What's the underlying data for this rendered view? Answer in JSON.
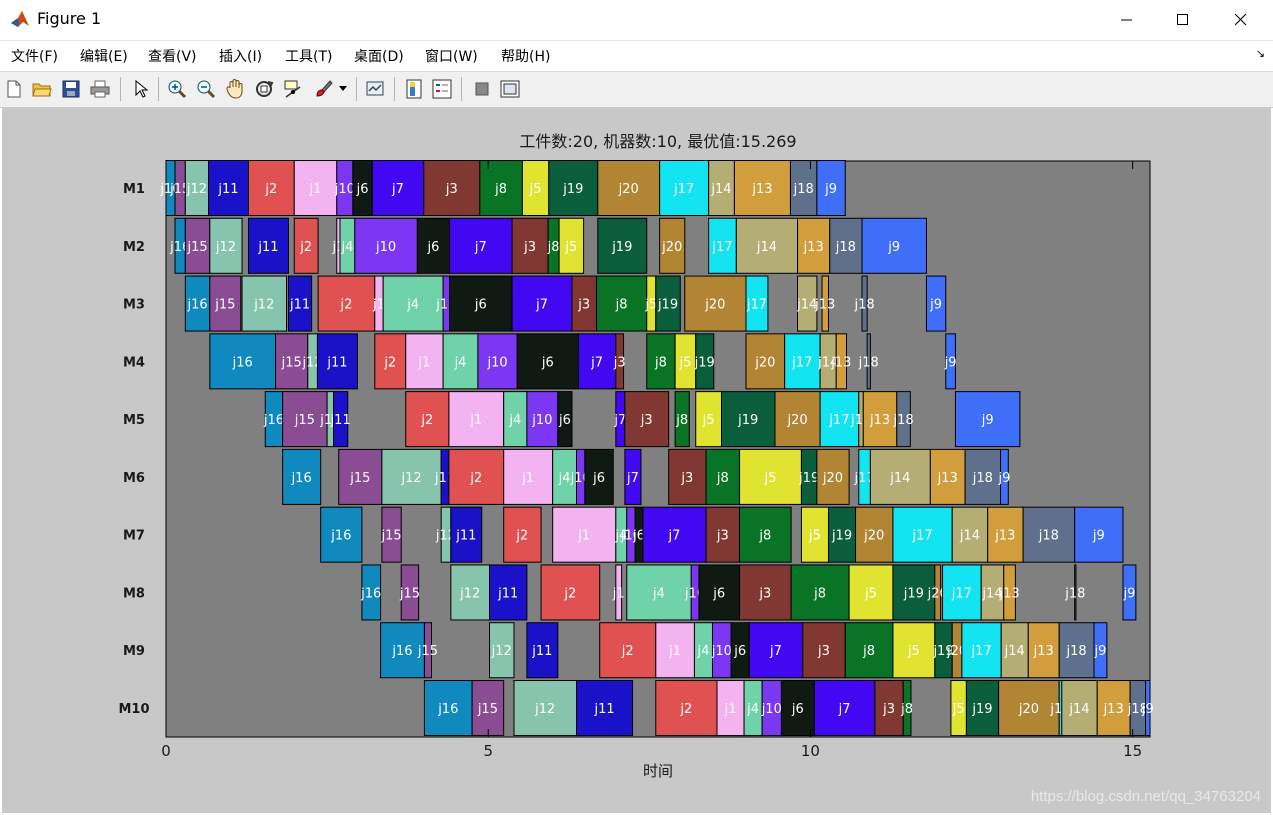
{
  "window": {
    "title": "Figure 1",
    "minimize_icon": "minimize-icon",
    "maximize_icon": "maximize-icon",
    "close_icon": "close-icon",
    "app_icon": "matlab-logo-icon"
  },
  "menu": [
    "文件(F)",
    "编辑(E)",
    "查看(V)",
    "插入(I)",
    "工具(T)",
    "桌面(D)",
    "窗口(W)",
    "帮助(H)"
  ],
  "toolbar": [
    {
      "name": "new-figure-button",
      "icon": "new-file-icon"
    },
    {
      "name": "open-file-button",
      "icon": "open-folder-icon"
    },
    {
      "name": "save-figure-button",
      "icon": "save-icon"
    },
    {
      "name": "print-figure-button",
      "icon": "printer-icon"
    },
    {
      "name": "edit-plot-button",
      "icon": "pointer-icon"
    },
    {
      "name": "zoom-in-button",
      "icon": "zoom-in-icon"
    },
    {
      "name": "zoom-out-button",
      "icon": "zoom-out-icon"
    },
    {
      "name": "pan-button",
      "icon": "hand-icon"
    },
    {
      "name": "rotate-3d-button",
      "icon": "rotate-icon"
    },
    {
      "name": "data-cursor-button",
      "icon": "data-cursor-icon"
    },
    {
      "name": "brush-button",
      "icon": "brush-icon"
    },
    {
      "name": "brush-dropdown-button",
      "icon": "caret-down-icon"
    },
    {
      "name": "link-plot-button",
      "icon": "link-plot-icon"
    },
    {
      "name": "insert-colorbar-button",
      "icon": "colorbar-icon"
    },
    {
      "name": "insert-legend-button",
      "icon": "legend-icon"
    },
    {
      "name": "hide-plot-tools-button",
      "icon": "hide-tools-icon"
    },
    {
      "name": "show-plot-tools-button",
      "icon": "show-tools-icon"
    }
  ],
  "watermark": "https://blog.csdn.net/qq_34763204",
  "colors": {
    "j1": "#f2b3f0",
    "j2": "#e05252",
    "j3": "#823832",
    "j4": "#6fd2a8",
    "j5": "#e0e430",
    "j6": "#0f1a12",
    "j7": "#4208f2",
    "j8": "#097426",
    "j9": "#3f6ef8",
    "j10": "#7b37f2",
    "j11": "#1a12c8",
    "j12": "#86c4ad",
    "j13": "#d29d3c",
    "j14": "#b4ad74",
    "j15": "#8a4d94",
    "j16": "#1089be",
    "j17": "#12e4f2",
    "j18": "#5f708c",
    "j19": "#0a5e3c",
    "j20": "#b28534",
    "plot_bg": "#808080",
    "figure_bg": "#c8c8c8"
  },
  "chart_data": {
    "type": "gantt",
    "title": "工件数:20, 机器数:10, 最优值:15.269",
    "xlabel": "时间",
    "ylabel": "",
    "xlim": [
      0,
      15.269
    ],
    "xticks": [
      0,
      5,
      10,
      15
    ],
    "machines": [
      "M1",
      "M2",
      "M3",
      "M4",
      "M5",
      "M6",
      "M7",
      "M8",
      "M9",
      "M10"
    ],
    "tasks": [
      [
        "M1",
        "j16",
        0.0,
        0.14
      ],
      [
        "M1",
        "j15",
        0.14,
        0.3
      ],
      [
        "M1",
        "j12",
        0.3,
        0.66
      ],
      [
        "M1",
        "j11",
        0.66,
        1.28
      ],
      [
        "M1",
        "j2",
        1.28,
        1.99
      ],
      [
        "M1",
        "j1",
        1.99,
        2.65
      ],
      [
        "M1",
        "j10",
        2.65,
        2.9
      ],
      [
        "M1",
        "j6",
        2.9,
        3.2
      ],
      [
        "M1",
        "j7",
        3.2,
        4.0
      ],
      [
        "M1",
        "j3",
        4.0,
        4.87
      ],
      [
        "M1",
        "j8",
        4.87,
        5.53
      ],
      [
        "M1",
        "j5",
        5.53,
        5.94
      ],
      [
        "M1",
        "j19",
        5.94,
        6.7
      ],
      [
        "M1",
        "j20",
        6.7,
        7.66
      ],
      [
        "M1",
        "j17",
        7.66,
        8.42
      ],
      [
        "M1",
        "j14",
        8.42,
        8.82
      ],
      [
        "M1",
        "j13",
        8.82,
        9.69
      ],
      [
        "M1",
        "j18",
        9.69,
        10.1
      ],
      [
        "M1",
        "j9",
        10.1,
        10.54
      ],
      [
        "M2",
        "j16",
        0.14,
        0.3
      ],
      [
        "M2",
        "j15",
        0.3,
        0.68
      ],
      [
        "M2",
        "j12",
        0.68,
        1.18
      ],
      [
        "M2",
        "j11",
        1.28,
        1.9
      ],
      [
        "M2",
        "j2",
        1.99,
        2.36
      ],
      [
        "M2",
        "j1",
        2.65,
        2.7
      ],
      [
        "M2",
        "j4",
        2.7,
        2.93
      ],
      [
        "M2",
        "j10",
        2.93,
        3.9
      ],
      [
        "M2",
        "j6",
        3.9,
        4.4
      ],
      [
        "M2",
        "j7",
        4.4,
        5.37
      ],
      [
        "M2",
        "j3",
        5.37,
        5.93
      ],
      [
        "M2",
        "j8",
        5.93,
        6.1
      ],
      [
        "M2",
        "j5",
        6.1,
        6.48
      ],
      [
        "M2",
        "j19",
        6.7,
        7.46
      ],
      [
        "M2",
        "j20",
        7.66,
        8.05
      ],
      [
        "M2",
        "j17",
        8.42,
        8.85
      ],
      [
        "M2",
        "j14",
        8.85,
        9.8
      ],
      [
        "M2",
        "j13",
        9.8,
        10.3
      ],
      [
        "M2",
        "j18",
        10.3,
        10.8
      ],
      [
        "M2",
        "j9",
        10.8,
        11.8
      ],
      [
        "M3",
        "j16",
        0.3,
        0.68
      ],
      [
        "M3",
        "j15",
        0.68,
        1.16
      ],
      [
        "M3",
        "j12",
        1.18,
        1.87
      ],
      [
        "M3",
        "j11",
        1.9,
        2.26
      ],
      [
        "M3",
        "j2",
        2.36,
        3.24
      ],
      [
        "M3",
        "j1",
        3.24,
        3.37
      ],
      [
        "M3",
        "j4",
        3.37,
        4.3
      ],
      [
        "M3",
        "j10",
        4.3,
        4.4
      ],
      [
        "M3",
        "j6",
        4.4,
        5.37
      ],
      [
        "M3",
        "j7",
        5.37,
        6.3
      ],
      [
        "M3",
        "j3",
        6.3,
        6.68
      ],
      [
        "M3",
        "j8",
        6.68,
        7.46
      ],
      [
        "M3",
        "j5",
        7.46,
        7.6
      ],
      [
        "M3",
        "j19",
        7.6,
        7.98
      ],
      [
        "M3",
        "j20",
        8.05,
        9.0
      ],
      [
        "M3",
        "j17",
        9.0,
        9.34
      ],
      [
        "M3",
        "j14",
        9.8,
        10.1
      ],
      [
        "M3",
        "j13",
        10.18,
        10.28
      ],
      [
        "M3",
        "j18",
        10.8,
        10.88
      ],
      [
        "M3",
        "j9",
        11.8,
        12.1
      ],
      [
        "M4",
        "j16",
        0.68,
        1.7
      ],
      [
        "M4",
        "j15",
        1.7,
        2.2
      ],
      [
        "M4",
        "j12",
        2.2,
        2.35
      ],
      [
        "M4",
        "j11",
        2.35,
        2.97
      ],
      [
        "M4",
        "j2",
        3.24,
        3.72
      ],
      [
        "M4",
        "j1",
        3.72,
        4.3
      ],
      [
        "M4",
        "j4",
        4.3,
        4.84
      ],
      [
        "M4",
        "j10",
        4.84,
        5.45
      ],
      [
        "M4",
        "j6",
        5.45,
        6.4
      ],
      [
        "M4",
        "j7",
        6.4,
        6.98
      ],
      [
        "M4",
        "j3",
        6.98,
        7.1
      ],
      [
        "M4",
        "j8",
        7.46,
        7.9
      ],
      [
        "M4",
        "j5",
        7.9,
        8.22
      ],
      [
        "M4",
        "j19",
        8.22,
        8.5
      ],
      [
        "M4",
        "j20",
        9.0,
        9.6
      ],
      [
        "M4",
        "j17",
        9.6,
        10.15
      ],
      [
        "M4",
        "j14",
        10.15,
        10.4
      ],
      [
        "M4",
        "j13",
        10.4,
        10.56
      ],
      [
        "M4",
        "j18",
        10.88,
        10.93
      ],
      [
        "M4",
        "j9",
        12.1,
        12.25
      ],
      [
        "M5",
        "j16",
        1.54,
        1.81
      ],
      [
        "M5",
        "j15",
        1.81,
        2.5
      ],
      [
        "M5",
        "j12",
        2.5,
        2.6
      ],
      [
        "M5",
        "j11",
        2.6,
        2.82
      ],
      [
        "M5",
        "j2",
        3.72,
        4.39
      ],
      [
        "M5",
        "j1",
        4.39,
        5.24
      ],
      [
        "M5",
        "j4",
        5.24,
        5.6
      ],
      [
        "M5",
        "j10",
        5.6,
        6.08
      ],
      [
        "M5",
        "j6",
        6.08,
        6.3
      ],
      [
        "M5",
        "j7",
        6.98,
        7.12
      ],
      [
        "M5",
        "j3",
        7.12,
        7.8
      ],
      [
        "M5",
        "j8",
        7.9,
        8.12
      ],
      [
        "M5",
        "j5",
        8.22,
        8.62
      ],
      [
        "M5",
        "j19",
        8.62,
        9.45
      ],
      [
        "M5",
        "j20",
        9.45,
        10.15
      ],
      [
        "M5",
        "j17",
        10.15,
        10.75
      ],
      [
        "M5",
        "j14",
        10.75,
        10.82
      ],
      [
        "M5",
        "j13",
        10.82,
        11.34
      ],
      [
        "M5",
        "j18",
        11.34,
        11.55
      ],
      [
        "M5",
        "j9",
        12.25,
        13.25
      ],
      [
        "M6",
        "j16",
        1.81,
        2.4
      ],
      [
        "M6",
        "j15",
        2.68,
        3.35
      ],
      [
        "M6",
        "j12",
        3.35,
        4.27
      ],
      [
        "M6",
        "j11",
        4.27,
        4.39
      ],
      [
        "M6",
        "j2",
        4.39,
        5.24
      ],
      [
        "M6",
        "j1",
        5.24,
        6.0
      ],
      [
        "M6",
        "j4",
        6.0,
        6.37
      ],
      [
        "M6",
        "j10",
        6.37,
        6.5
      ],
      [
        "M6",
        "j6",
        6.5,
        6.94
      ],
      [
        "M6",
        "j7",
        7.12,
        7.37
      ],
      [
        "M6",
        "j3",
        7.8,
        8.38
      ],
      [
        "M6",
        "j8",
        8.38,
        8.9
      ],
      [
        "M6",
        "j5",
        8.9,
        9.86
      ],
      [
        "M6",
        "j19",
        9.86,
        10.1
      ],
      [
        "M6",
        "j20",
        10.1,
        10.6
      ],
      [
        "M6",
        "j17",
        10.75,
        10.93
      ],
      [
        "M6",
        "j14",
        10.93,
        11.86
      ],
      [
        "M6",
        "j13",
        11.86,
        12.4
      ],
      [
        "M6",
        "j18",
        12.4,
        12.95
      ],
      [
        "M6",
        "j9",
        12.95,
        13.07
      ],
      [
        "M7",
        "j16",
        2.4,
        3.04
      ],
      [
        "M7",
        "j15",
        3.35,
        3.65
      ],
      [
        "M7",
        "j12",
        4.27,
        4.42
      ],
      [
        "M7",
        "j11",
        4.42,
        4.9
      ],
      [
        "M7",
        "j2",
        5.24,
        5.82
      ],
      [
        "M7",
        "j1",
        6.0,
        6.98
      ],
      [
        "M7",
        "j4",
        6.98,
        7.15
      ],
      [
        "M7",
        "j10",
        7.15,
        7.28
      ],
      [
        "M7",
        "j6",
        7.28,
        7.4
      ],
      [
        "M7",
        "j7",
        7.4,
        8.38
      ],
      [
        "M7",
        "j3",
        8.38,
        8.9
      ],
      [
        "M7",
        "j8",
        8.9,
        9.7
      ],
      [
        "M7",
        "j5",
        9.86,
        10.28
      ],
      [
        "M7",
        "j19",
        10.28,
        10.7
      ],
      [
        "M7",
        "j20",
        10.7,
        11.28
      ],
      [
        "M7",
        "j17",
        11.28,
        12.2
      ],
      [
        "M7",
        "j14",
        12.2,
        12.75
      ],
      [
        "M7",
        "j13",
        12.75,
        13.3
      ],
      [
        "M7",
        "j18",
        13.3,
        14.1
      ],
      [
        "M7",
        "j9",
        14.1,
        14.85
      ],
      [
        "M8",
        "j16",
        3.04,
        3.33
      ],
      [
        "M8",
        "j15",
        3.65,
        3.92
      ],
      [
        "M8",
        "j12",
        4.42,
        5.02
      ],
      [
        "M8",
        "j11",
        5.02,
        5.6
      ],
      [
        "M8",
        "j2",
        5.82,
        6.73
      ],
      [
        "M8",
        "j1",
        6.98,
        7.07
      ],
      [
        "M8",
        "j4",
        7.15,
        8.15
      ],
      [
        "M8",
        "j10",
        8.15,
        8.27
      ],
      [
        "M8",
        "j6",
        8.27,
        8.9
      ],
      [
        "M8",
        "j3",
        8.9,
        9.7
      ],
      [
        "M8",
        "j8",
        9.7,
        10.6
      ],
      [
        "M8",
        "j5",
        10.6,
        11.28
      ],
      [
        "M8",
        "j19",
        11.28,
        11.93
      ],
      [
        "M8",
        "j20",
        11.93,
        12.02
      ],
      [
        "M8",
        "j17",
        12.05,
        12.65
      ],
      [
        "M8",
        "j14",
        12.65,
        13.0
      ],
      [
        "M8",
        "j13",
        13.0,
        13.18
      ],
      [
        "M8",
        "j18",
        14.1,
        14.12
      ],
      [
        "M8",
        "j9",
        14.85,
        15.05
      ],
      [
        "M9",
        "j16",
        3.33,
        4.01
      ],
      [
        "M9",
        "j15",
        4.01,
        4.12
      ],
      [
        "M9",
        "j12",
        5.02,
        5.4
      ],
      [
        "M9",
        "j11",
        5.6,
        6.08
      ],
      [
        "M9",
        "j2",
        6.73,
        7.6
      ],
      [
        "M9",
        "j1",
        7.6,
        8.2
      ],
      [
        "M9",
        "j4",
        8.2,
        8.48
      ],
      [
        "M9",
        "j10",
        8.48,
        8.77
      ],
      [
        "M9",
        "j6",
        8.77,
        9.05
      ],
      [
        "M9",
        "j7",
        9.05,
        9.88
      ],
      [
        "M9",
        "j3",
        9.88,
        10.54
      ],
      [
        "M9",
        "j8",
        10.54,
        11.28
      ],
      [
        "M9",
        "j5",
        11.28,
        11.93
      ],
      [
        "M9",
        "j19",
        11.93,
        12.2
      ],
      [
        "M9",
        "j20",
        12.2,
        12.35
      ],
      [
        "M9",
        "j17",
        12.35,
        12.96
      ],
      [
        "M9",
        "j14",
        12.96,
        13.38
      ],
      [
        "M9",
        "j13",
        13.38,
        13.86
      ],
      [
        "M9",
        "j18",
        13.86,
        14.4
      ],
      [
        "M9",
        "j9",
        14.4,
        14.6
      ],
      [
        "M10",
        "j16",
        4.01,
        4.75
      ],
      [
        "M10",
        "j15",
        4.75,
        5.24
      ],
      [
        "M10",
        "j12",
        5.4,
        6.37
      ],
      [
        "M10",
        "j11",
        6.37,
        7.24
      ],
      [
        "M10",
        "j2",
        7.6,
        8.55
      ],
      [
        "M10",
        "j1",
        8.55,
        8.97
      ],
      [
        "M10",
        "j4",
        8.97,
        9.25
      ],
      [
        "M10",
        "j10",
        9.25,
        9.55
      ],
      [
        "M10",
        "j6",
        9.55,
        10.06
      ],
      [
        "M10",
        "j7",
        10.06,
        11.0
      ],
      [
        "M10",
        "j3",
        11.0,
        11.44
      ],
      [
        "M10",
        "j8",
        11.44,
        11.56
      ],
      [
        "M10",
        "j5",
        12.18,
        12.42
      ],
      [
        "M10",
        "j19",
        12.42,
        12.92
      ],
      [
        "M10",
        "j20",
        12.92,
        13.86
      ],
      [
        "M10",
        "j17",
        13.86,
        13.9
      ],
      [
        "M10",
        "j14",
        13.9,
        14.45
      ],
      [
        "M10",
        "j13",
        14.45,
        14.96
      ],
      [
        "M10",
        "j18",
        14.96,
        15.2
      ],
      [
        "M10",
        "j9",
        15.2,
        15.269
      ]
    ]
  }
}
